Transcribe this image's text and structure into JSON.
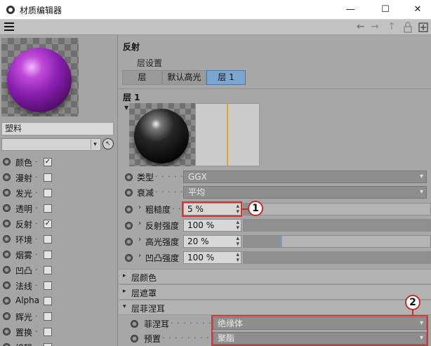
{
  "window": {
    "title": "材质编辑器",
    "minimize": "—",
    "maximize": "☐",
    "close": "✕"
  },
  "nav": {
    "back": "←",
    "forward": "→",
    "up": "↑",
    "lock": "🔒",
    "new": "⊞"
  },
  "material": {
    "name": "塑料",
    "combo_value": ""
  },
  "channels": [
    {
      "label": "颜色",
      "checked": true
    },
    {
      "label": "漫射",
      "checked": false
    },
    {
      "label": "发光",
      "checked": false
    },
    {
      "label": "透明",
      "checked": false
    },
    {
      "label": "反射",
      "checked": true
    },
    {
      "label": "环境",
      "checked": false
    },
    {
      "label": "烟雾",
      "checked": false
    },
    {
      "label": "凹凸",
      "checked": false
    },
    {
      "label": "法线",
      "checked": false
    },
    {
      "label": "Alpha",
      "checked": false
    },
    {
      "label": "辉光",
      "checked": false
    },
    {
      "label": "置换",
      "checked": false
    },
    {
      "label": "编辑",
      "checked": false
    }
  ],
  "reflection": {
    "section_title": "反射",
    "layer_settings_label": "层设置",
    "tabs": [
      "层",
      "默认高光",
      "层 1"
    ],
    "active_tab": "层 1",
    "layer_title": "层 1"
  },
  "properties": {
    "type": {
      "label": "类型",
      "value": "GGX"
    },
    "attenuation": {
      "label": "衰减",
      "value": "平均"
    },
    "roughness": {
      "label": "粗糙度",
      "value": "5 %",
      "level": 0.05
    },
    "reflect_strength": {
      "label": "反射强度",
      "value": "100 %",
      "level": 1.0
    },
    "specular_strength": {
      "label": "高光强度",
      "value": "20 %",
      "level": 0.2
    },
    "bump_strength": {
      "label": "凹凸强度",
      "value": "100 %",
      "level": 1.0
    }
  },
  "groups": {
    "layer_color": "层颜色",
    "layer_mask": "层遮罩",
    "layer_fresnel": "层菲涅耳"
  },
  "fresnel": {
    "fresnel_label": "菲涅耳",
    "fresnel_value": "绝缘体",
    "preset_label": "预置",
    "preset_value": "聚酯"
  },
  "callouts": {
    "one": "1",
    "two": "2"
  },
  "colors": {
    "active_tab": "#7aa6cf",
    "highlight": "#d9342b",
    "graph_line": "#e8a12a"
  }
}
